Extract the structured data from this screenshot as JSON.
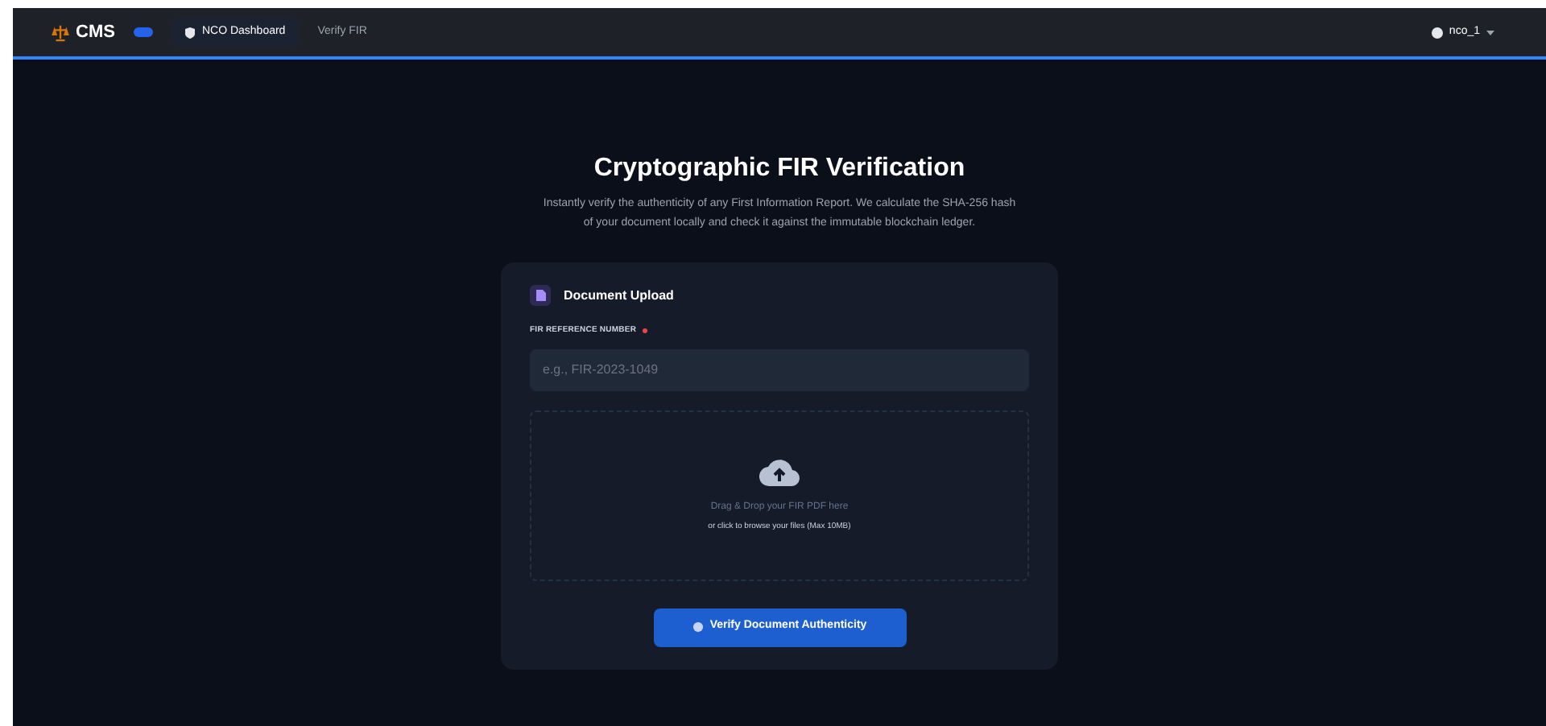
{
  "nav": {
    "brand": "CMS",
    "links": [
      {
        "label": "NCO Dashboard",
        "selected": true
      },
      {
        "label": "Verify FIR",
        "selected": false
      }
    ],
    "user": "nco_1"
  },
  "hero": {
    "title": "Cryptographic FIR Verification",
    "description": "Instantly verify the authenticity of any First Information Report. We calculate the SHA-256 hash of your document locally and check it against the immutable blockchain ledger."
  },
  "card": {
    "title": "Document Upload",
    "field": {
      "label": "FIR REFERENCE NUMBER",
      "required": true,
      "placeholder": "e.g., FIR-2023-1049"
    },
    "dropzone": {
      "title": "Drag & Drop your FIR PDF here",
      "hint": "or click to browse your files (Max 10MB)"
    },
    "button": "Verify Document Authenticity"
  }
}
